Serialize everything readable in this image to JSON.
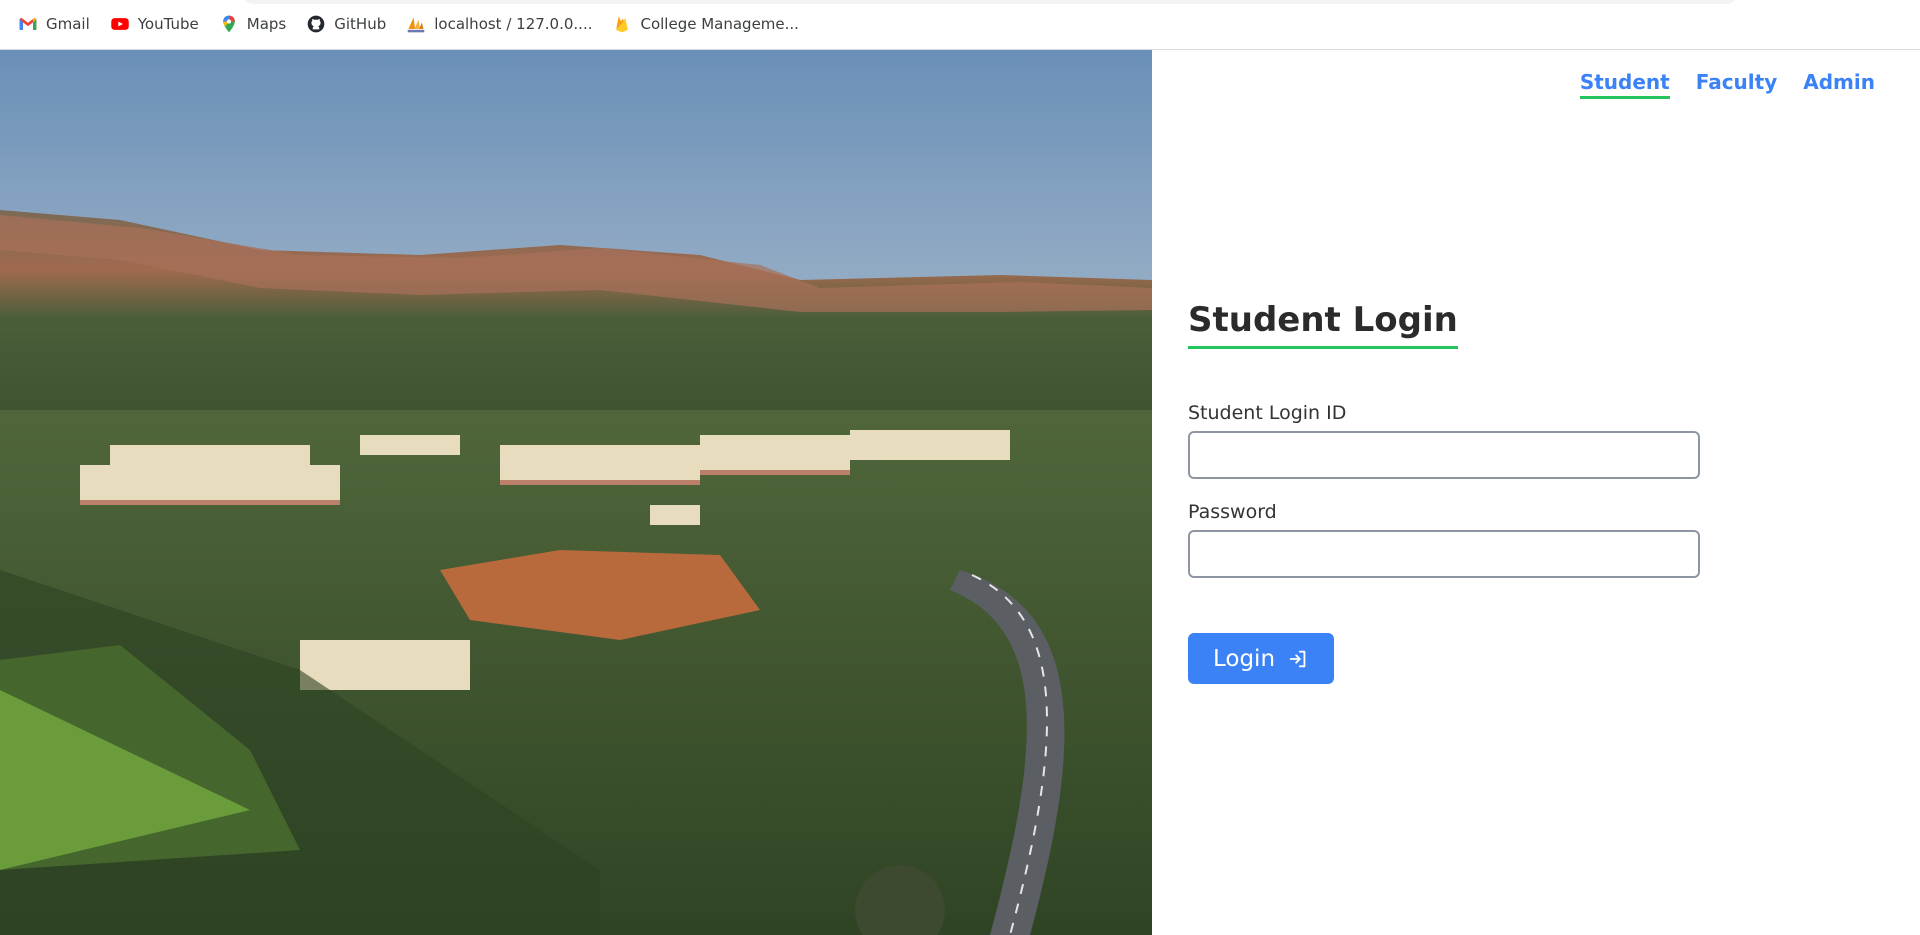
{
  "bookmarks": [
    {
      "label": "Gmail",
      "icon": "gmail-icon"
    },
    {
      "label": "YouTube",
      "icon": "youtube-icon"
    },
    {
      "label": "Maps",
      "icon": "maps-pin-icon"
    },
    {
      "label": "GitHub",
      "icon": "github-icon"
    },
    {
      "label": "localhost / 127.0.0....",
      "icon": "phpmyadmin-icon"
    },
    {
      "label": "College Manageme...",
      "icon": "firebase-icon"
    }
  ],
  "hero": {
    "description_icon": "campus-aerial-photo"
  },
  "nav": {
    "tabs": [
      "Student",
      "Faculty",
      "Admin"
    ],
    "active": "Student"
  },
  "login": {
    "title": "Student Login",
    "id_label": "Student Login ID",
    "id_value": "",
    "password_label": "Password",
    "password_value": "",
    "button_label": "Login",
    "button_icon": "login-arrow-icon"
  },
  "colors": {
    "accent": "#3b82f6",
    "underline": "#22c55e",
    "title": "#2b2b2b"
  }
}
